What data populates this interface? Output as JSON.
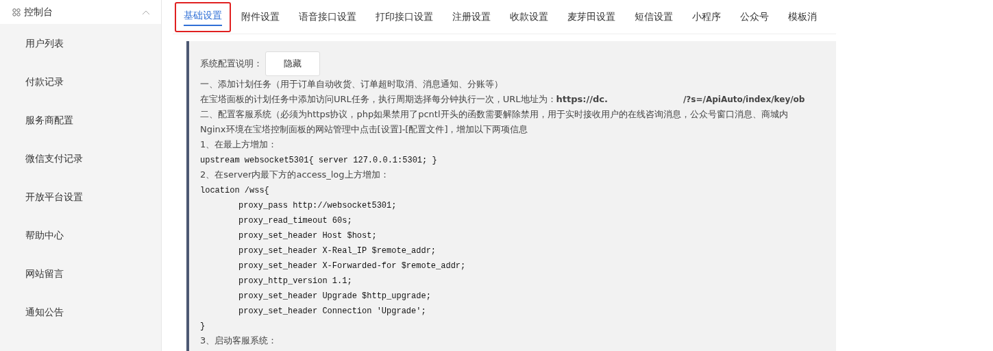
{
  "sidebar": {
    "header": {
      "label": "控制台",
      "expanded": true
    },
    "items": [
      {
        "label": "用户列表"
      },
      {
        "label": "付款记录"
      },
      {
        "label": "服务商配置"
      },
      {
        "label": "微信支付记录"
      },
      {
        "label": "开放平台设置"
      },
      {
        "label": "帮助中心"
      },
      {
        "label": "网站留言"
      },
      {
        "label": "通知公告"
      }
    ]
  },
  "tabs": [
    {
      "label": "基础设置",
      "selected": true
    },
    {
      "label": "附件设置",
      "selected": false
    },
    {
      "label": "语音接口设置",
      "selected": false
    },
    {
      "label": "打印接口设置",
      "selected": false
    },
    {
      "label": "注册设置",
      "selected": false
    },
    {
      "label": "收款设置",
      "selected": false
    },
    {
      "label": "麦芽田设置",
      "selected": false
    },
    {
      "label": "短信设置",
      "selected": false
    },
    {
      "label": "小程序",
      "selected": false
    },
    {
      "label": "公众号",
      "selected": false
    },
    {
      "label": "模板消",
      "selected": false
    }
  ],
  "notice": {
    "label": "系统配置说明：",
    "button": "隐藏",
    "lines": [
      {
        "kind": "text",
        "text": "一、添加计划任务（用于订单自动收货、订单超时取消、消息通知、分账等）"
      },
      {
        "kind": "url",
        "text": "在宝塔面板的计划任务中添加访问URL任务，执行周期选择每分钟执行一次，URL地址为：",
        "url_start": "https://dc.",
        "url_end": "/?s=/ApiAuto/index/key/ob"
      },
      {
        "kind": "text",
        "text": "二、配置客服系统（必须为https协议，php如果禁用了pcntl开头的函数需要解除禁用，用于实时接收用户的在线咨询消息，公众号窗口消息、商城内"
      },
      {
        "kind": "text",
        "text": "Nginx环境在宝塔控制面板的网站管理中点击[设置]-[配置文件]，增加以下两项信息"
      },
      {
        "kind": "text",
        "text": "1、在最上方增加："
      },
      {
        "kind": "code",
        "text": "upstream websocket5301{ server 127.0.0.1:5301; }"
      },
      {
        "kind": "text",
        "text": "2、在server内最下方的access_log上方增加："
      },
      {
        "kind": "code",
        "text": "location /wss{"
      },
      {
        "kind": "code-indent",
        "text": "proxy_pass http://websocket5301;"
      },
      {
        "kind": "code-indent",
        "text": "proxy_read_timeout 60s;"
      },
      {
        "kind": "code-indent",
        "text": "proxy_set_header Host $host;"
      },
      {
        "kind": "code-indent",
        "text": "proxy_set_header X-Real_IP $remote_addr;"
      },
      {
        "kind": "code-indent",
        "text": "proxy_set_header X-Forwarded-for $remote_addr;"
      },
      {
        "kind": "code-indent",
        "text": "proxy_http_version 1.1;"
      },
      {
        "kind": "code-indent",
        "text": "proxy_set_header Upgrade $http_upgrade;"
      },
      {
        "kind": "code-indent",
        "text": "proxy_set_header Connection 'Upgrade';"
      },
      {
        "kind": "code",
        "text": "}"
      },
      {
        "kind": "text",
        "text": "3、启动客服系统："
      }
    ]
  }
}
